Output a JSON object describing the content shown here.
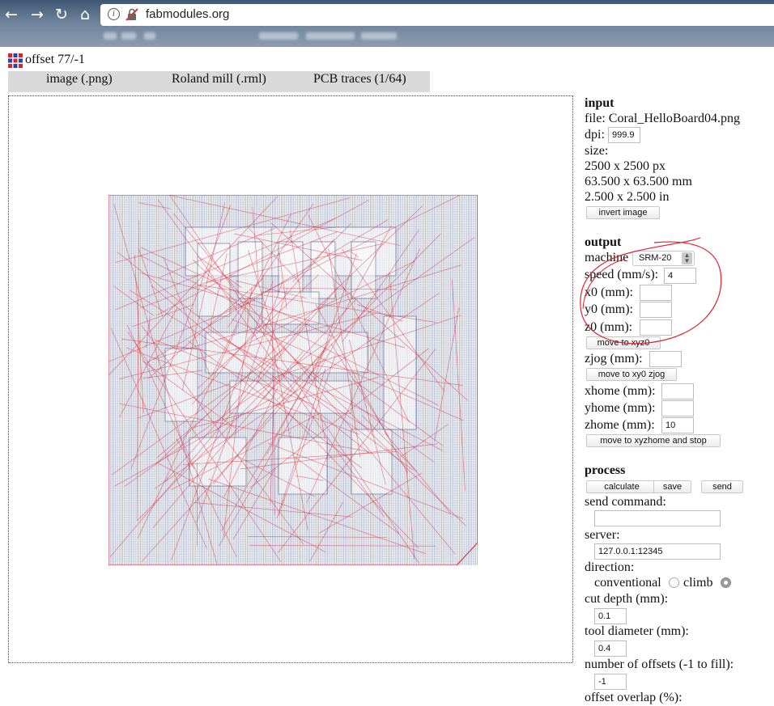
{
  "browser": {
    "url": "fabmodules.org",
    "nav_icons": [
      "back-arrow-icon",
      "forward-arrow-icon",
      "reload-icon",
      "home-icon"
    ]
  },
  "app": {
    "title": "offset 77/-1",
    "tabs": [
      "image (.png)",
      "Roland mill (.rml)",
      "PCB traces (1/64)"
    ]
  },
  "input": {
    "header": "input",
    "file_label": "file:",
    "file_name": "Coral_HelloBoard04.png",
    "dpi_label": "dpi:",
    "dpi_value": "999.9",
    "size_label": "size:",
    "size_px": "2500 x 2500 px",
    "size_mm": "63.500 x 63.500 mm",
    "size_in": "2.500 x 2.500 in",
    "invert_button": "invert image"
  },
  "output": {
    "header": "output",
    "machine_label": "machine",
    "machine_value": "SRM-20",
    "speed_label": "speed (mm/s):",
    "speed_value": "4",
    "x0_label": "x0 (mm):",
    "x0_value": "",
    "y0_label": "y0 (mm):",
    "y0_value": "",
    "z0_label": "z0 (mm):",
    "z0_value": "",
    "move_xyz0_button": "move to xyz0",
    "zjog_label": "zjog (mm):",
    "zjog_value": "",
    "move_xy0_zjog_button": "move to xy0 zjog",
    "xhome_label": "xhome (mm):",
    "xhome_value": "",
    "yhome_label": "yhome (mm):",
    "yhome_value": "",
    "zhome_label": "zhome (mm):",
    "zhome_value": "10",
    "move_home_button": "move to xyzhome and stop"
  },
  "process": {
    "header": "process",
    "calculate_button": "calculate",
    "save_button": "save",
    "send_button": "send",
    "send_command_label": "send command:",
    "send_command_value": "",
    "server_label": "server:",
    "server_value": "127.0.0.1:12345",
    "direction_label": "direction:",
    "conventional_label": "conventional",
    "climb_label": "climb",
    "direction_selected": "climb",
    "cut_depth_label": "cut depth (mm):",
    "cut_depth_value": "0.1",
    "tool_diameter_label": "tool diameter (mm):",
    "tool_diameter_value": "0.4",
    "offsets_label": "number of offsets (-1 to fill):",
    "offsets_value": "-1",
    "overlap_label": "offset overlap (%):"
  },
  "colors": {
    "path_blue": "#2a3d78",
    "path_red": "#e0202a",
    "annotation_red": "#e0202a",
    "tab_bar_bg": "#d9d9d9"
  }
}
